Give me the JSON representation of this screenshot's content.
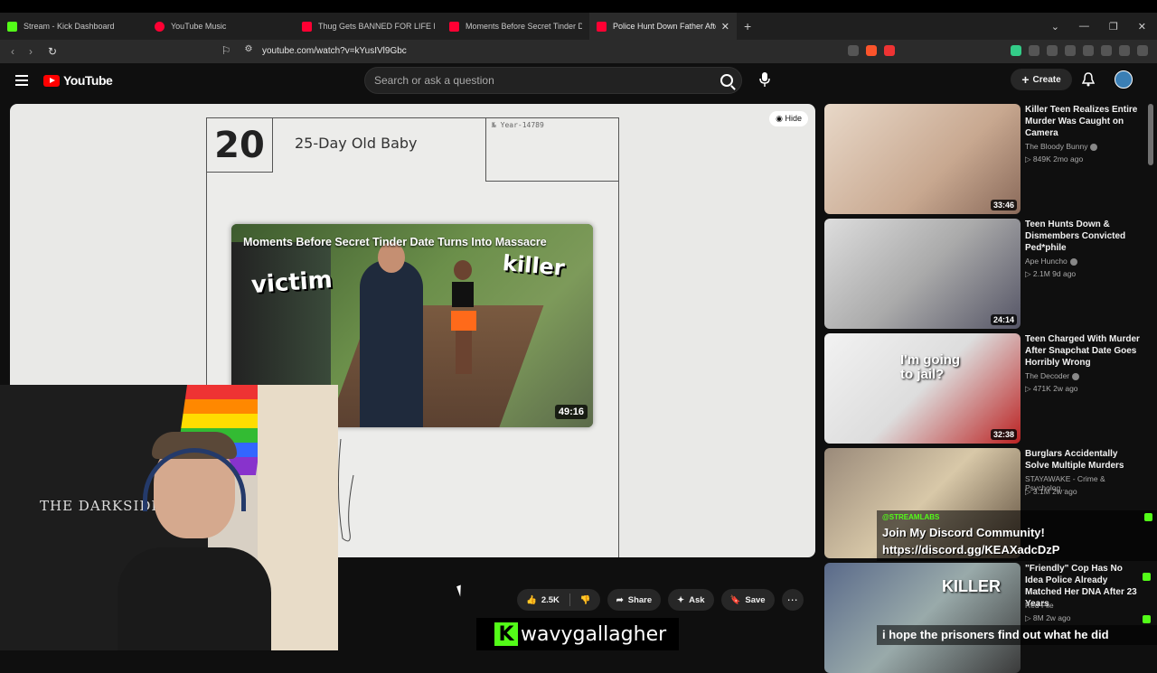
{
  "browser": {
    "tabs": [
      {
        "title": "Stream - Kick Dashboard",
        "color": "#53fc18"
      },
      {
        "title": "YouTube Music",
        "color": "#ff0033"
      },
      {
        "title": "Thug Gets BANNED FOR LIFE From t",
        "color": "#ff0033"
      },
      {
        "title": "Moments Before Secret Tinder Date",
        "color": "#ff0033"
      },
      {
        "title": "Police Hunt Down Father After M",
        "color": "#ff0033"
      }
    ],
    "url": "youtube.com/watch?v=kYusIVl9Gbc"
  },
  "youtube": {
    "logo_text": "YouTube",
    "search_placeholder": "Search or ask a question",
    "create_label": "Create"
  },
  "player": {
    "episode_number": "20",
    "episode_title": "25-Day Old Baby",
    "year_text": "№ Year-14789",
    "hide_label": "Hide",
    "endcard": {
      "title": "Moments Before Secret Tinder Date Turns Into Massacre",
      "label_victim": "victim",
      "label_killer": "killer",
      "duration": "49:16"
    }
  },
  "actions": {
    "likes": "2.5K",
    "share": "Share",
    "ask": "Ask",
    "save": "Save"
  },
  "recommendations": [
    {
      "title": "Killer Teen Realizes Entire Murder Was Caught on Camera",
      "channel": "The Bloody Bunny",
      "meta": "▷ 849K  2mo ago",
      "duration": "33:46"
    },
    {
      "title": "Teen Hunts Down & Dismembers Convicted Ped*phile",
      "channel": "Ape Huncho",
      "meta": "▷ 2.1M  9d ago",
      "duration": "24:14"
    },
    {
      "title": "Teen Charged With Murder After Snapchat Date Goes Horribly Wrong",
      "channel": "The Decoder",
      "meta": "▷ 471K  2w ago",
      "duration": "32:38",
      "thumb_caption": "I'm going to jail?"
    },
    {
      "title": "Burglars Accidentally Solve Multiple Murders",
      "channel": "STAYAWAKE - Crime & Psycholog...",
      "meta": "▷ 3.1M  2w ago",
      "duration": ""
    },
    {
      "title": "\"Friendly\" Cop Has No Idea Police Already Matched Her DNA After 23 Years",
      "channel": "Red File",
      "meta": "▷ 8M  2w ago",
      "duration": "",
      "thumb_caption": "KILLER"
    }
  ],
  "webcam": {
    "shirt_text": "THE DARKSIDE"
  },
  "stream_overlay": {
    "tag": "@STREAMLABS",
    "line1": "Join My Discord Community!",
    "line2": "https://discord.gg/KEAXadcDzP",
    "chat_message": "i hope the prisoners find out what he did",
    "streamer_name": "wavygallagher",
    "kick_letter": "K"
  }
}
